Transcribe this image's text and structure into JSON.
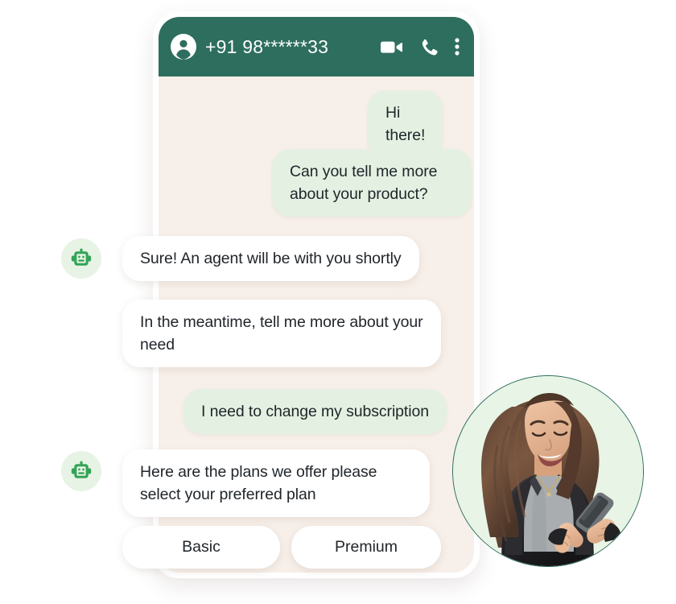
{
  "colors": {
    "header_green": "#2E6E5E",
    "chat_background": "#F7EFE9",
    "outgoing_bubble": "#E4F1E2",
    "incoming_bubble": "#FFFFFF",
    "bot_avatar_bg": "#E7F3E5",
    "bot_icon_green": "#33A457",
    "photo_circle_bg": "#E8F4E6",
    "text_dark": "#21262B"
  },
  "header": {
    "contact_name": "+91 98******33",
    "avatar_icon": "person-avatar-icon",
    "actions": [
      {
        "name": "video-call-icon",
        "label": "Video call"
      },
      {
        "name": "voice-call-icon",
        "label": "Voice call"
      },
      {
        "name": "more-options-icon",
        "label": "More options"
      }
    ]
  },
  "messages": [
    {
      "id": 0,
      "sender": "user",
      "text": "Hi there!",
      "has_avatar": false
    },
    {
      "id": 1,
      "sender": "user",
      "text": "Can you tell me more about your product?",
      "has_avatar": false
    },
    {
      "id": 2,
      "sender": "bot",
      "text": "Sure! An agent will be with you shortly",
      "has_avatar": true
    },
    {
      "id": 3,
      "sender": "bot",
      "text": "In the meantime, tell me more about your need",
      "has_avatar": false
    },
    {
      "id": 4,
      "sender": "user",
      "text": "I need to change my subscription",
      "has_avatar": false
    },
    {
      "id": 5,
      "sender": "bot",
      "text": "Here are the plans we offer please select your preferred plan",
      "has_avatar": true
    }
  ],
  "quick_replies": [
    {
      "id": 0,
      "label": "Basic"
    },
    {
      "id": 1,
      "label": "Premium"
    }
  ],
  "photo": {
    "name": "woman-using-phone-photo",
    "alt": "Smiling woman with long wavy brown hair in a black leather jacket holding a smartphone"
  }
}
